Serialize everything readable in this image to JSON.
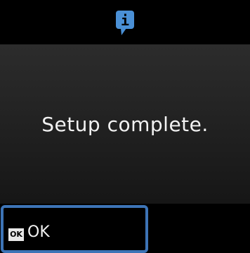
{
  "header": {
    "icon": "info-icon",
    "icon_glyph": "i",
    "icon_color": "#4a90d6"
  },
  "message": {
    "text": "Setup complete."
  },
  "footer": {
    "ok_key": "OK",
    "ok_label": "OK",
    "highlight_color": "#3d74b6"
  }
}
